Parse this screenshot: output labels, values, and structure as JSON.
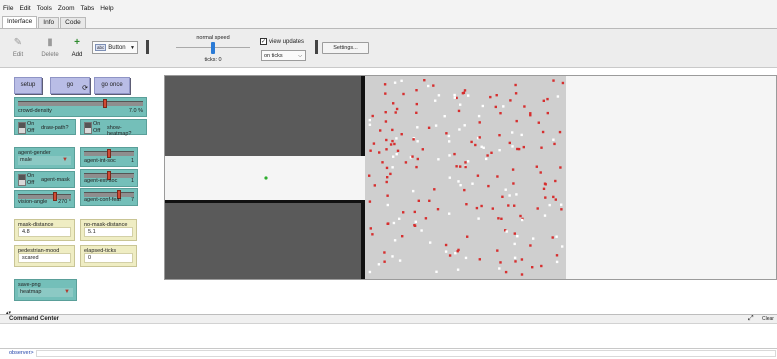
{
  "menu": [
    "File",
    "Edit",
    "Tools",
    "Zoom",
    "Tabs",
    "Help"
  ],
  "tabs": [
    {
      "label": "Interface",
      "active": true
    },
    {
      "label": "Info",
      "active": false
    },
    {
      "label": "Code",
      "active": false
    }
  ],
  "toolbar": {
    "edit": "Edit",
    "delete": "Delete",
    "add": "Add",
    "widget_type": "Button",
    "widget_badge": "abc",
    "speed_label": "normal speed",
    "speed_fraction": 0.5,
    "ticks_label": "ticks: 0",
    "view_updates_label": "view updates",
    "view_updates_checked": true,
    "update_mode": "on ticks",
    "settings_label": "Settings..."
  },
  "widgets": {
    "setup": "setup",
    "go": "go",
    "go_once": "go once",
    "crowd_density": {
      "name": "crowd-density",
      "value": "7.0 %",
      "fraction": 0.7
    },
    "draw_path": {
      "name": "draw-path?",
      "on": "On",
      "off": "Off"
    },
    "show_heatmap": {
      "name": "show-heatmap?",
      "on": "On",
      "off": "Off"
    },
    "agent_gender": {
      "name": "agent-gender",
      "value": "male"
    },
    "agent_int_soc": {
      "name": "agent-int-soc",
      "value": "1",
      "fraction": 0.5
    },
    "agent_ext_soc": {
      "name": "agent-ext-soc",
      "value": "1",
      "fraction": 0.5
    },
    "agent_mask": {
      "name": "agent-mask",
      "on": "On",
      "off": "Off"
    },
    "agent_conf_fear": {
      "name": "agent-conf-fear",
      "value": "7",
      "fraction": 0.72
    },
    "vision_angle": {
      "name": "vision-angle",
      "value": "270 °",
      "fraction": 0.72
    },
    "mask_distance": {
      "name": "mask-distance",
      "value": "4.8"
    },
    "no_mask_distance": {
      "name": "no-mask-distance",
      "value": "5.1"
    },
    "pedestrian_mood": {
      "name": "pedestrian-mood",
      "value": "scared"
    },
    "elapsed_ticks": {
      "name": "elapsed-ticks",
      "value": "0"
    },
    "save_png": {
      "name": "save-png",
      "value": "heatmap"
    }
  },
  "colors": {
    "button": "#b9bde6",
    "slider": "#74bfb9",
    "monitor": "#efedc3",
    "wall": "#5a5a5a",
    "crowd_area": "#cfcfcf",
    "agent_red": "#d62f2f",
    "agent_white": "#ffffff",
    "player": "#2fae2f"
  },
  "command_center": {
    "title": "Command Center",
    "clear": "Clear",
    "prompt": "observer>"
  }
}
